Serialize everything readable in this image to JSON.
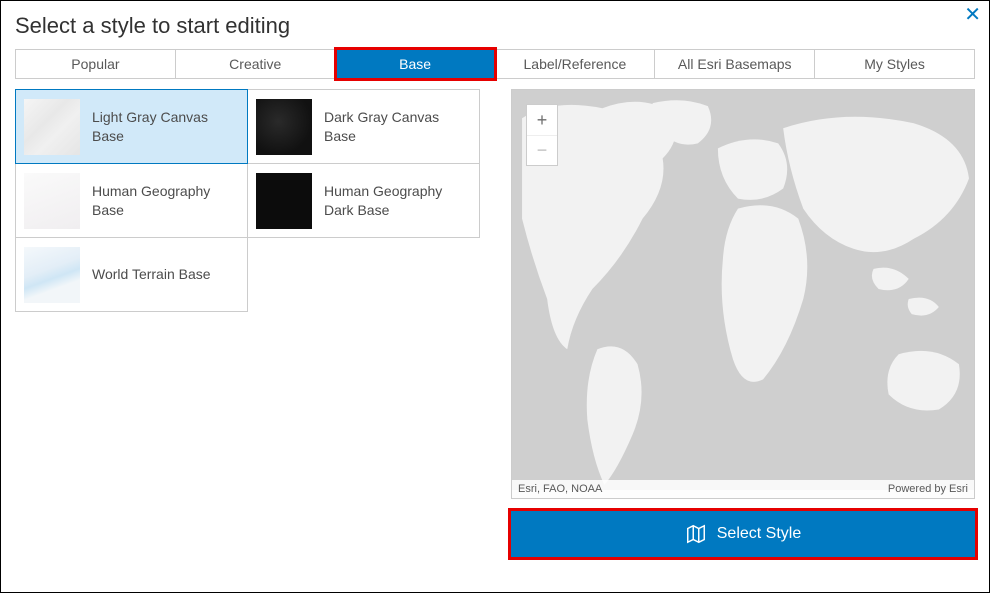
{
  "title": "Select a style to start editing",
  "close_glyph": "✕",
  "tabs": [
    {
      "label": "Popular"
    },
    {
      "label": "Creative"
    },
    {
      "label": "Base"
    },
    {
      "label": "Label/Reference"
    },
    {
      "label": "All Esri Basemaps"
    },
    {
      "label": "My Styles"
    }
  ],
  "active_tab_index": 2,
  "styles": [
    {
      "label": "Light Gray Canvas Base",
      "thumb": "light",
      "selected": true
    },
    {
      "label": "Dark Gray Canvas Base",
      "thumb": "dark",
      "selected": false
    },
    {
      "label": "Human Geography Base",
      "thumb": "humlight",
      "selected": false
    },
    {
      "label": "Human Geography Dark Base",
      "thumb": "humdark",
      "selected": false
    },
    {
      "label": "World Terrain Base",
      "thumb": "terrain",
      "selected": false
    }
  ],
  "zoom": {
    "in": "+",
    "out": "−"
  },
  "attribution": {
    "left": "Esri, FAO, NOAA",
    "right": "Powered by Esri"
  },
  "select_button": "Select Style"
}
